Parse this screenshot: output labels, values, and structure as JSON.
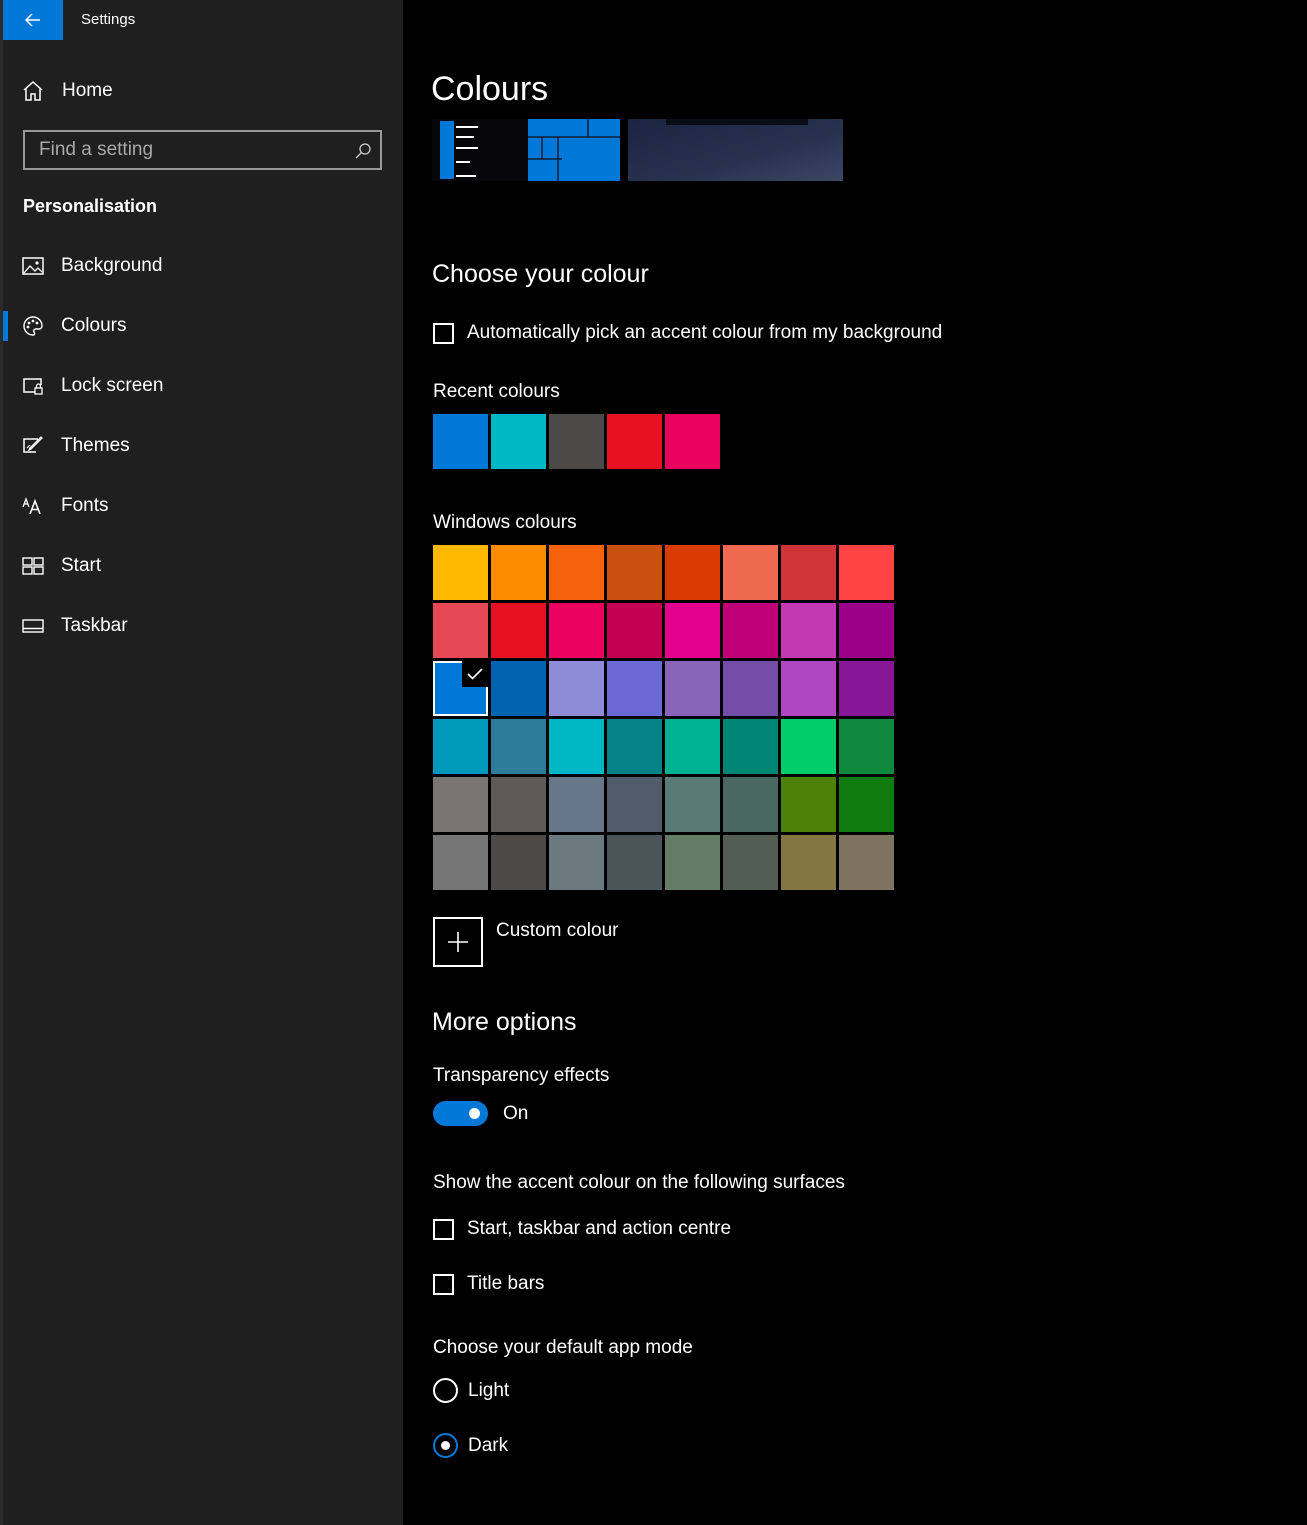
{
  "window": {
    "title": "Settings"
  },
  "sidebar": {
    "home_label": "Home",
    "search_placeholder": "Find a setting",
    "section_title": "Personalisation",
    "items": [
      {
        "label": "Background",
        "icon": "picture-icon"
      },
      {
        "label": "Colours",
        "icon": "palette-icon",
        "selected": true
      },
      {
        "label": "Lock screen",
        "icon": "lock-screen-icon"
      },
      {
        "label": "Themes",
        "icon": "themes-icon"
      },
      {
        "label": "Fonts",
        "icon": "fonts-icon"
      },
      {
        "label": "Start",
        "icon": "start-icon"
      },
      {
        "label": "Taskbar",
        "icon": "taskbar-icon"
      }
    ],
    "accent": "#0078d7"
  },
  "main": {
    "title": "Colours",
    "choose_heading": "Choose your colour",
    "auto_pick_label": "Automatically pick an accent colour from my background",
    "recent_label": "Recent colours",
    "recent_colours": [
      "#0078d7",
      "#00b7c3",
      "#4c4a48",
      "#e81123",
      "#ea005e"
    ],
    "windows_label": "Windows colours",
    "windows_colours": [
      [
        "#ffb900",
        "#ff8c00",
        "#f7630c",
        "#ca5010",
        "#da3b01",
        "#ef6950",
        "#d13438",
        "#ff4343"
      ],
      [
        "#e74856",
        "#e81123",
        "#ea005e",
        "#c30052",
        "#e3008c",
        "#bf0077",
        "#c239b3",
        "#9a0089"
      ],
      [
        "#0078d7",
        "#0063b1",
        "#8e8cd8",
        "#6b69d6",
        "#8764b8",
        "#744da9",
        "#b146c2",
        "#881798"
      ],
      [
        "#0099bc",
        "#2d7d9a",
        "#00b7c3",
        "#038387",
        "#00b294",
        "#018574",
        "#00cc6a",
        "#10893e"
      ],
      [
        "#7a7574",
        "#5d5a58",
        "#68768a",
        "#515c6b",
        "#567c73",
        "#486860",
        "#498205",
        "#107c10"
      ],
      [
        "#767676",
        "#4c4a48",
        "#69797e",
        "#4a5459",
        "#647c64",
        "#525e54",
        "#847545",
        "#7e735f"
      ]
    ],
    "selected_colour": "#0078d7",
    "custom_label": "Custom colour",
    "more_heading": "More options",
    "transparency_label": "Transparency effects",
    "transparency_state": "On",
    "surfaces_label": "Show the accent colour on the following surfaces",
    "surface_start_label": "Start, taskbar and action centre",
    "surface_titlebars_label": "Title bars",
    "app_mode_label": "Choose your default app mode",
    "mode_light": "Light",
    "mode_dark": "Dark",
    "mode_selected": "Dark"
  }
}
